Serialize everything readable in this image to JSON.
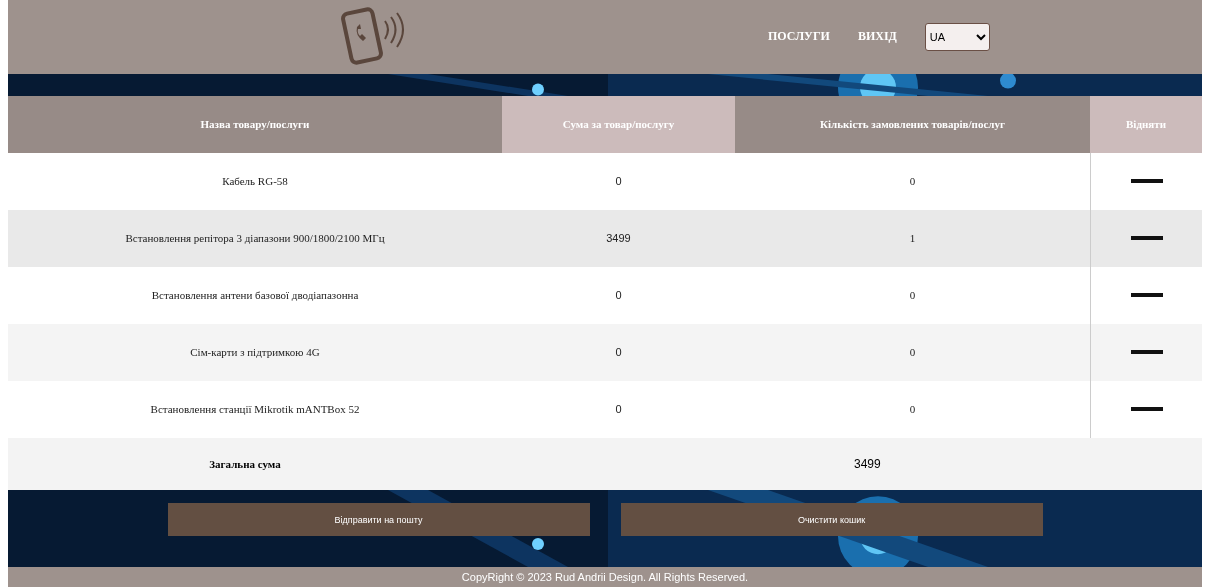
{
  "nav": {
    "links": [
      "ПОСЛУГИ",
      "ВИХІД"
    ],
    "language": "UA"
  },
  "table": {
    "columns": [
      "Назва товару/послуги",
      "Сума за товар/послугу",
      "Кількість замовлених товарів/послуг",
      "Відняти"
    ],
    "rows": [
      {
        "name": "Кабель RG-58",
        "sum": "0",
        "quantity": "0"
      },
      {
        "name": "Встановлення репітора 3 діапазони 900/1800/2100 МГц",
        "sum": "3499",
        "quantity": "1"
      },
      {
        "name": "Встановлення антени базової дводіапазонна",
        "sum": "0",
        "quantity": "0"
      },
      {
        "name": "Сім-карти з підтримкою 4G",
        "sum": "0",
        "quantity": "0"
      },
      {
        "name": "Встановлення станції Mikrotik mANTBox 52",
        "sum": "0",
        "quantity": "0"
      }
    ],
    "total": {
      "label": "Загальна сума",
      "value": "3499"
    }
  },
  "buttons": [
    "Відправити на пошту",
    "Очистити кошик"
  ],
  "footer": "CopyRight © 2023 Rud Andrii Design. All Rights Reserved."
}
